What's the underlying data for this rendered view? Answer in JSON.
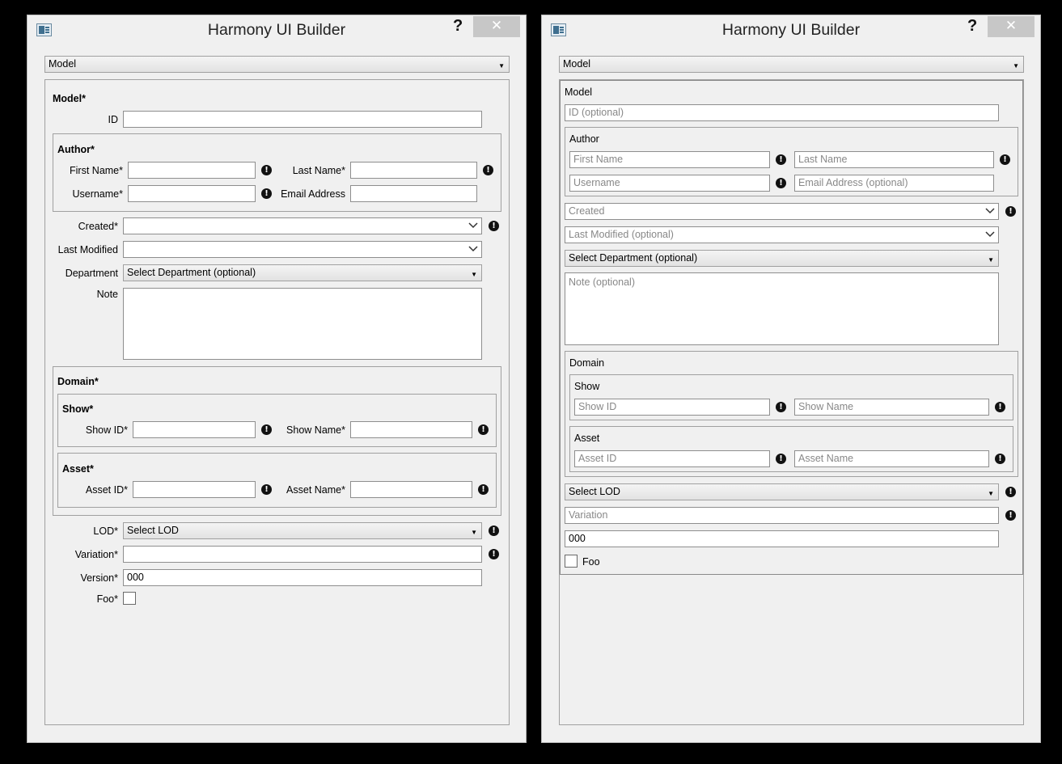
{
  "app": {
    "title": "Harmony UI Builder",
    "help_label": "?",
    "close_label": "✕"
  },
  "left": {
    "selector": "Model",
    "model_title": "Model*",
    "id_label": "ID",
    "author_title": "Author*",
    "first_name_label": "First Name*",
    "last_name_label": "Last Name*",
    "username_label": "Username*",
    "email_label": "Email Address",
    "created_label": "Created*",
    "last_modified_label": "Last Modified",
    "department_label": "Department",
    "department_value": "Select Department (optional)",
    "note_label": "Note",
    "domain_title": "Domain*",
    "show_title": "Show*",
    "show_id_label": "Show ID*",
    "show_name_label": "Show Name*",
    "asset_title": "Asset*",
    "asset_id_label": "Asset ID*",
    "asset_name_label": "Asset Name*",
    "lod_label": "LOD*",
    "lod_value": "Select LOD",
    "variation_label": "Variation*",
    "version_label": "Version*",
    "version_value": "000",
    "foo_label": "Foo*"
  },
  "right": {
    "selector": "Model",
    "model_title": "Model",
    "id_placeholder": "ID (optional)",
    "author_title": "Author",
    "first_name_placeholder": "First Name",
    "last_name_placeholder": "Last Name",
    "username_placeholder": "Username",
    "email_placeholder": "Email Address (optional)",
    "created_placeholder": "Created",
    "last_modified_placeholder": "Last Modified (optional)",
    "department_value": "Select Department (optional)",
    "note_placeholder": "Note (optional)",
    "domain_title": "Domain",
    "show_title": "Show",
    "show_id_placeholder": "Show ID",
    "show_name_placeholder": "Show Name",
    "asset_title": "Asset",
    "asset_id_placeholder": "Asset ID",
    "asset_name_placeholder": "Asset Name",
    "lod_value": "Select LOD",
    "variation_placeholder": "Variation",
    "version_value": "000",
    "foo_label": "Foo"
  },
  "icons": {
    "warning": "!"
  }
}
